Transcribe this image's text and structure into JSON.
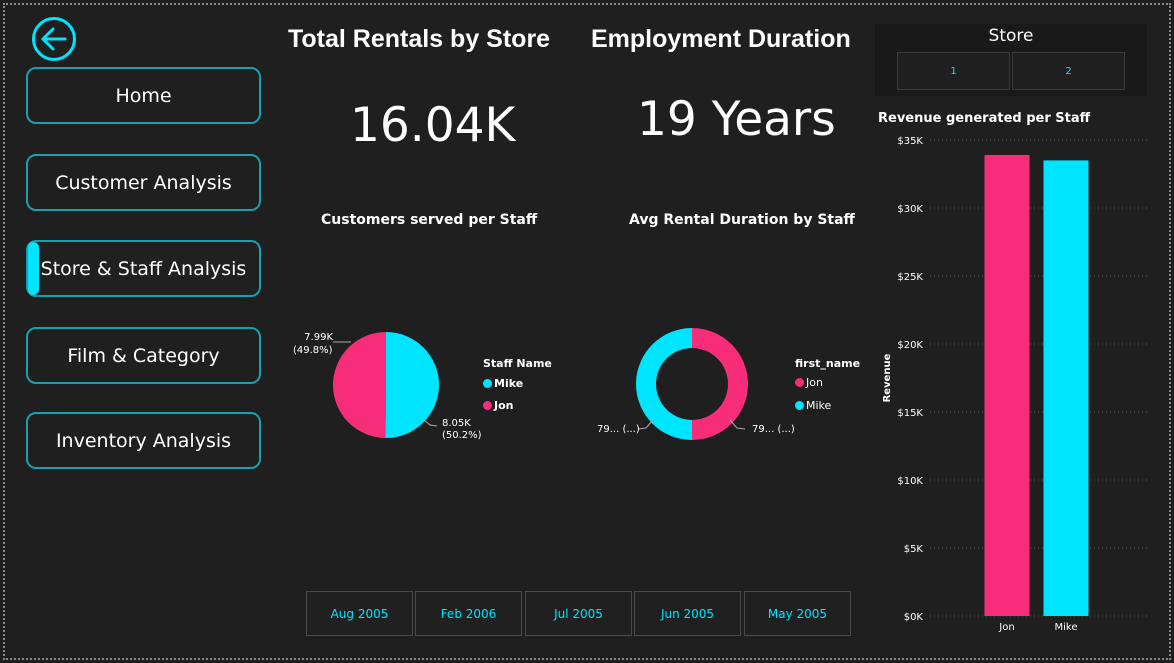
{
  "nav": {
    "items": [
      {
        "label": "Home"
      },
      {
        "label": "Customer Analysis"
      },
      {
        "label": "Store & Staff Analysis",
        "active": true
      },
      {
        "label": "Film & Category"
      },
      {
        "label": "Inventory Analysis"
      }
    ]
  },
  "kpis": {
    "rentals": {
      "title": "Total Rentals by Store",
      "value": "16.04K"
    },
    "employment": {
      "title": "Employment Duration",
      "value": "19 Years"
    }
  },
  "slicer": {
    "title": "Store",
    "options": [
      "1",
      "2"
    ]
  },
  "date_slicer": {
    "options": [
      "Aug 2005",
      "Feb 2006",
      "Jul 2005",
      "Jun 2005",
      "May 2005"
    ]
  },
  "colors": {
    "pink": "#f72d7a",
    "cyan": "#00e5ff",
    "accent": "#17a0b0"
  },
  "icons": {
    "back": "arrow-left-circle-icon"
  },
  "chart_data": [
    {
      "type": "pie",
      "title": "Customers served per Staff",
      "legend_title": "Staff Name",
      "legend": [
        "Mike",
        "Jon"
      ],
      "slices": [
        {
          "name": "Mike",
          "value": 8050,
          "label": "8.05K",
          "pct": "(50.2%)",
          "color": "#00e5ff"
        },
        {
          "name": "Jon",
          "value": 7990,
          "label": "7.99K",
          "pct": "(49.8%)",
          "color": "#f72d7a"
        }
      ]
    },
    {
      "type": "pie",
      "subtype": "donut",
      "title": "Avg Rental Duration by Staff",
      "legend_title": "first_name",
      "legend": [
        "Jon",
        "Mike"
      ],
      "slices": [
        {
          "name": "Jon",
          "value": 50,
          "label": "79... (...)",
          "color": "#f72d7a"
        },
        {
          "name": "Mike",
          "value": 50,
          "label": "79... (...)",
          "color": "#00e5ff"
        }
      ]
    },
    {
      "type": "bar",
      "title": "Revenue generated per Staff",
      "ylabel": "Revenue",
      "xlabel": "",
      "categories": [
        "Jon",
        "Mike"
      ],
      "values": [
        33900,
        33500
      ],
      "colors": [
        "#f72d7a",
        "#00e5ff"
      ],
      "ylim": [
        0,
        35000
      ],
      "yticks": [
        "$0K",
        "$5K",
        "$10K",
        "$15K",
        "$20K",
        "$25K",
        "$30K",
        "$35K"
      ],
      "grid": true
    }
  ]
}
